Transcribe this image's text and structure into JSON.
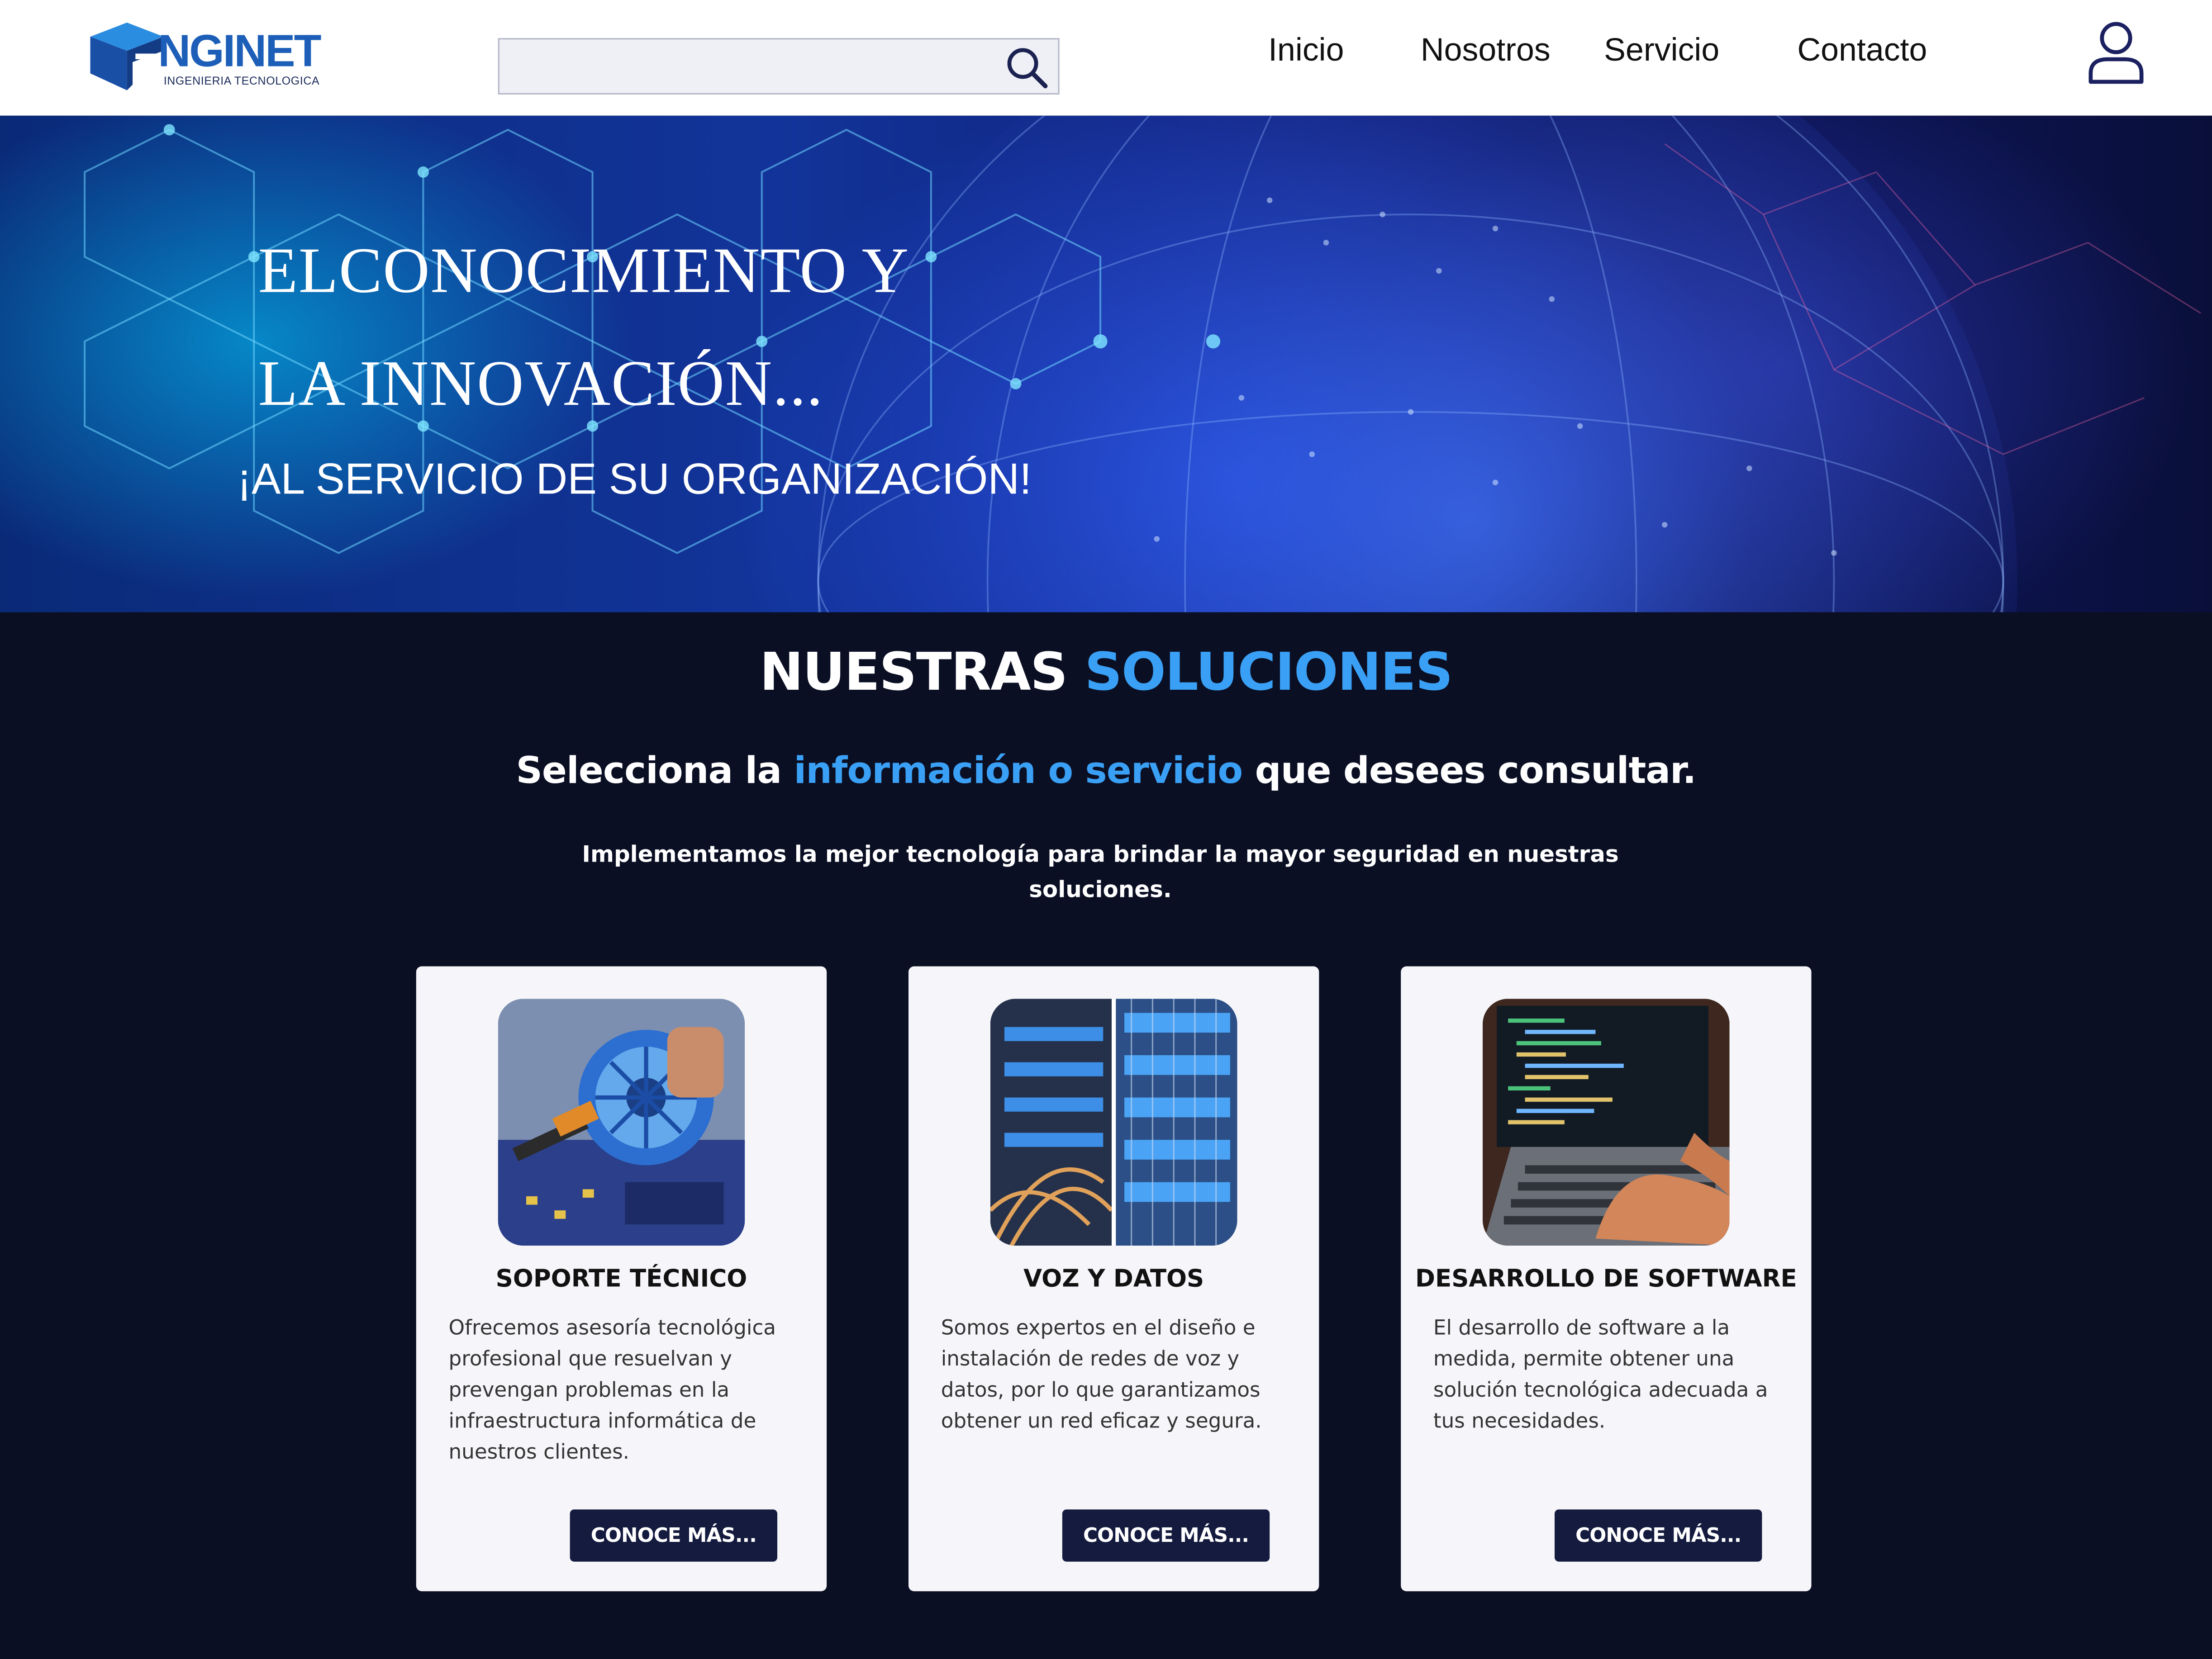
{
  "header": {
    "logo_text": "NGINET",
    "logo_subtitle": "INGENIERIA TECNOLOGICA",
    "search_placeholder": "",
    "nav": [
      "Inicio",
      "Nosotros",
      "Servicio",
      "Contacto"
    ]
  },
  "hero": {
    "title_line1": "ELCONOCIMIENTO Y",
    "title_line2": "LA INNOVACIÓN...",
    "subtitle": "¡AL SERVICIO DE SU ORGANIZACIÓN!"
  },
  "solutions": {
    "title_part1": "NUESTRAS ",
    "title_part2": "SOLUCIONES",
    "lead_part1": "Selecciona la ",
    "lead_part2": "información o servicio",
    "lead_part3": " que desees consultar.",
    "description": "Implementamos la mejor tecnología para brindar la mayor seguridad en nuestras soluciones.",
    "cards": [
      {
        "title": "SOPORTE TÉCNICO",
        "text": "Ofrecemos asesoría tecnológica profesional que resuelvan y prevengan problemas en la infraestructura informática de nuestros clientes.",
        "button": "CONOCE MÁS..."
      },
      {
        "title": "VOZ Y DATOS",
        "text": "Somos expertos en el diseño e instalación de redes de voz y datos, por lo que garantizamos obtener un red eficaz y segura.",
        "button": "CONOCE MÁS..."
      },
      {
        "title": "DESARROLLO DE SOFTWARE",
        "text": "El desarrollo de software a la medida, permite obtener una solución tecnológica adecuada a tus necesidades.",
        "button": "CONOCE MÁS..."
      }
    ]
  },
  "colors": {
    "accent": "#3aa0f5",
    "page_background": "#0b0f24",
    "button_background": "#141b3e",
    "brand_blue": "#1d5fb8"
  },
  "icons": [
    "search-icon",
    "user-icon",
    "logo-mark-icon"
  ]
}
